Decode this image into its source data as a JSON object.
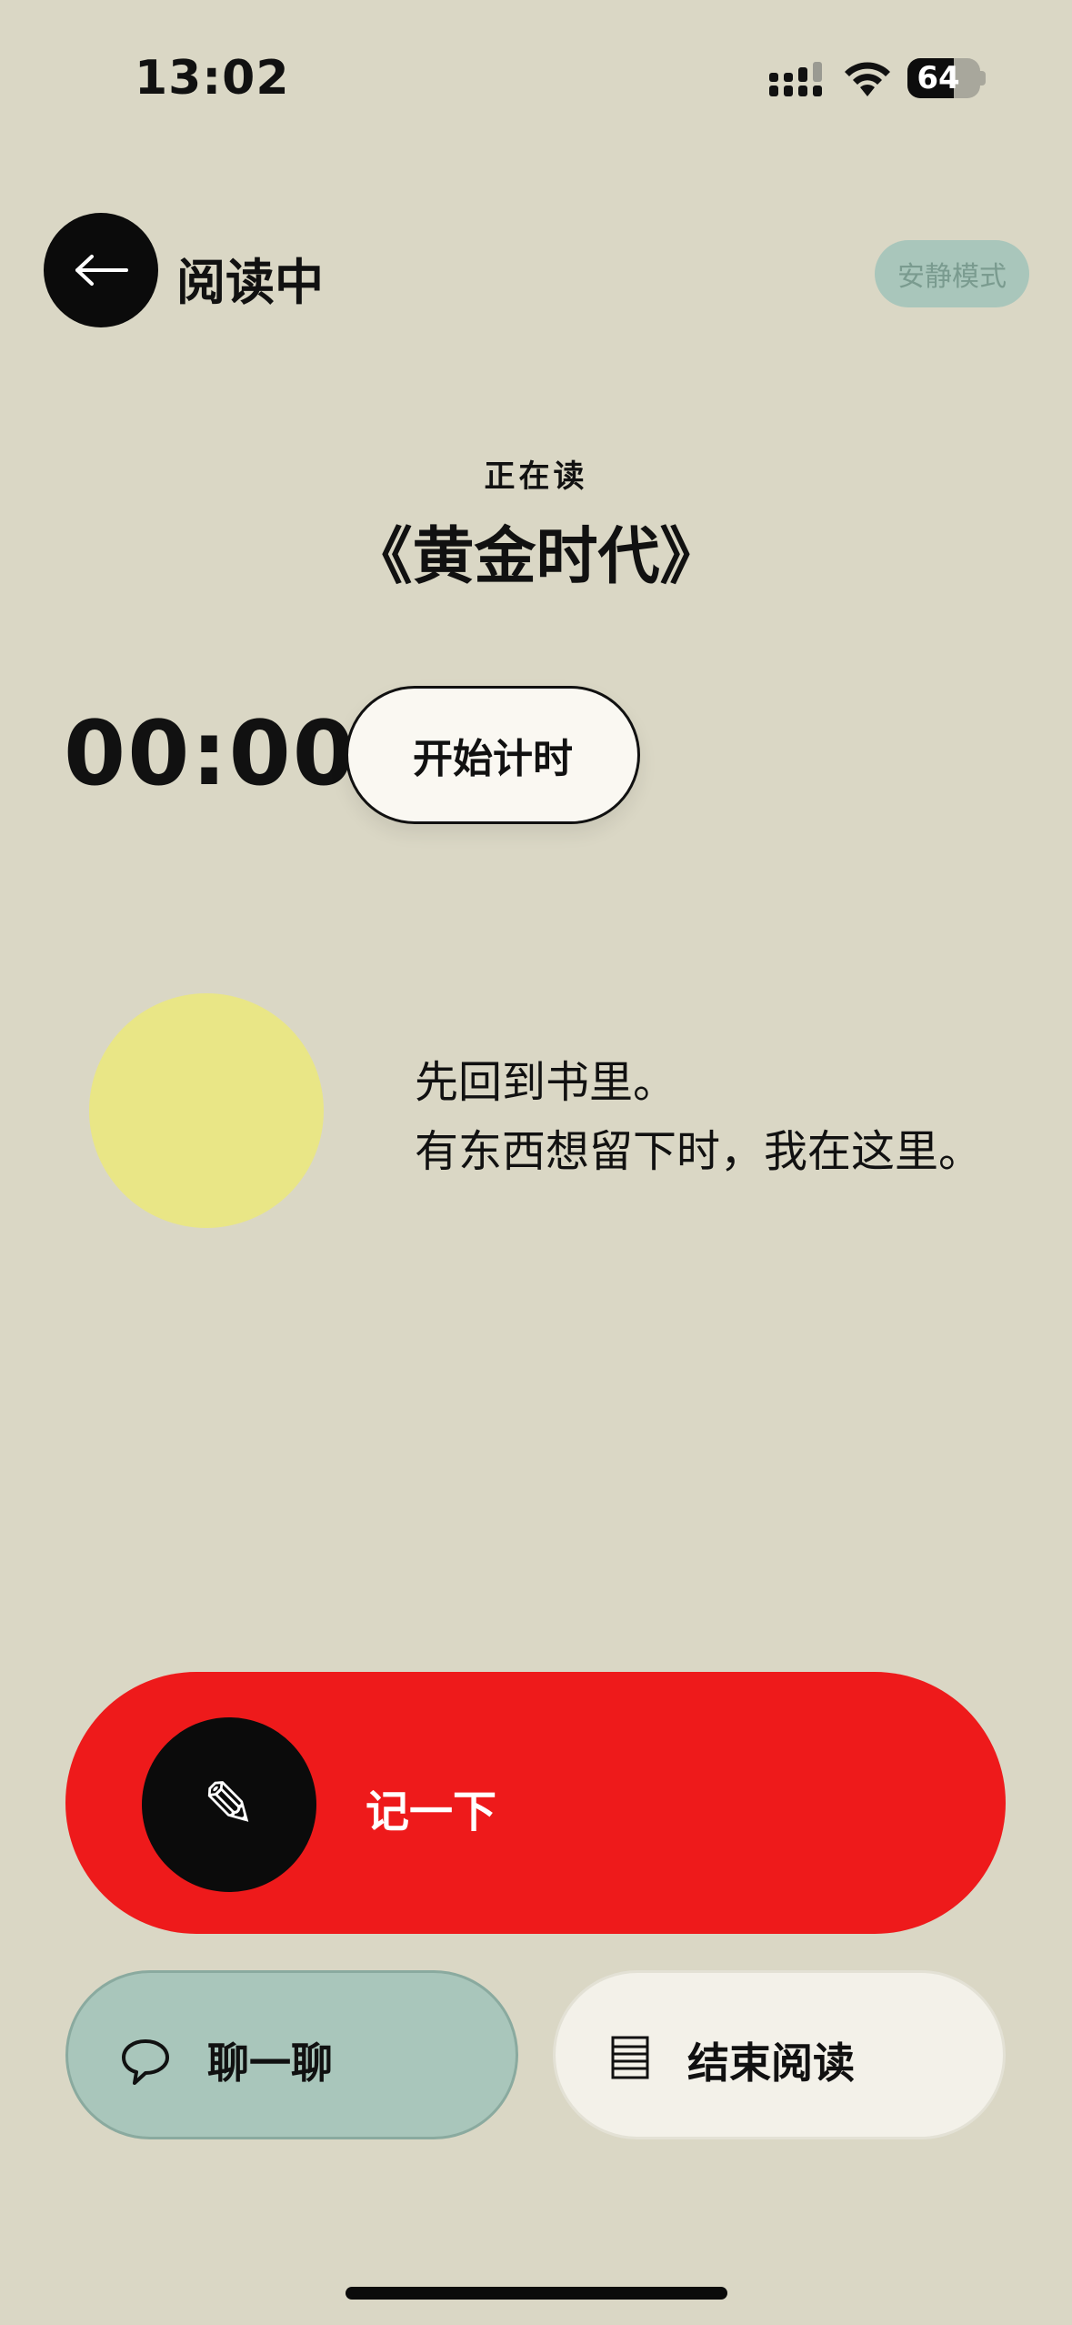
{
  "status_bar": {
    "time": "13:02",
    "battery": "64",
    "battery_level_percent": 64
  },
  "header": {
    "back_icon": "arrow-left-icon",
    "title": "阅读中",
    "quiet_mode": "安静模式"
  },
  "reading": {
    "label": "正在读",
    "book_title": "《黄金时代》"
  },
  "timer": {
    "display": "00:00",
    "start_label": "开始计时"
  },
  "companion": {
    "message_line1": "先回到书里。",
    "message_line2": "有东西想留下时，我在这里。"
  },
  "actions": {
    "note_icon": "pencil-icon",
    "note_label": "记一下",
    "chat_icon": "speech-bubble-icon",
    "chat_label": "聊一聊",
    "end_icon": "notes-icon",
    "end_label": "结束阅读"
  },
  "colors": {
    "background": "#dad7c5",
    "accent_red": "#ee1a1b",
    "mint": "#a9c6bb",
    "yellow_blob": "#e9e686",
    "card_light": "#f3f1e9"
  }
}
